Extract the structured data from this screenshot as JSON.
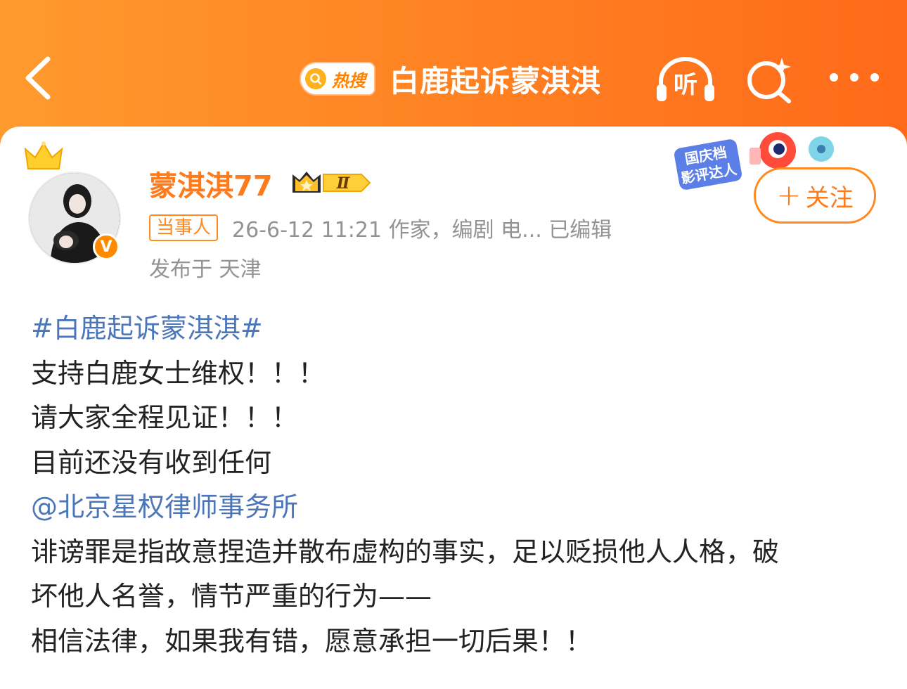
{
  "header": {
    "hot_badge": "热搜",
    "title": "白鹿起诉蒙淇淇",
    "listen_label": "听"
  },
  "post": {
    "author": "蒙淇淇77",
    "level": "Ⅱ",
    "role_tag": "当事人",
    "meta": "26-6-12 11:21  作家，编剧 电...  已编辑",
    "location": "发布于 天津",
    "follow_label": "关注",
    "event_badge": {
      "line1": "国庆档",
      "line2": "影评达人"
    },
    "verified_mark": "V",
    "hashtag": "#白鹿起诉蒙淇淇#",
    "line1": "支持白鹿女士维权！！！",
    "line2": "请大家全程见证！！！",
    "line3": "目前还没有收到任何",
    "mention": "@北京星权律师事务所",
    "line4": "诽谤罪是指故意捏造并散布虚构的事实，足以贬损他人人格，破",
    "line5": "坏他人名誉，情节严重的行为——",
    "line6": "相信法律，如果我有错，愿意承担一切后果！！"
  },
  "colors": {
    "brand_orange": "#ff8a1f",
    "link_blue": "#4b76b9",
    "meta_gray": "#939393"
  }
}
